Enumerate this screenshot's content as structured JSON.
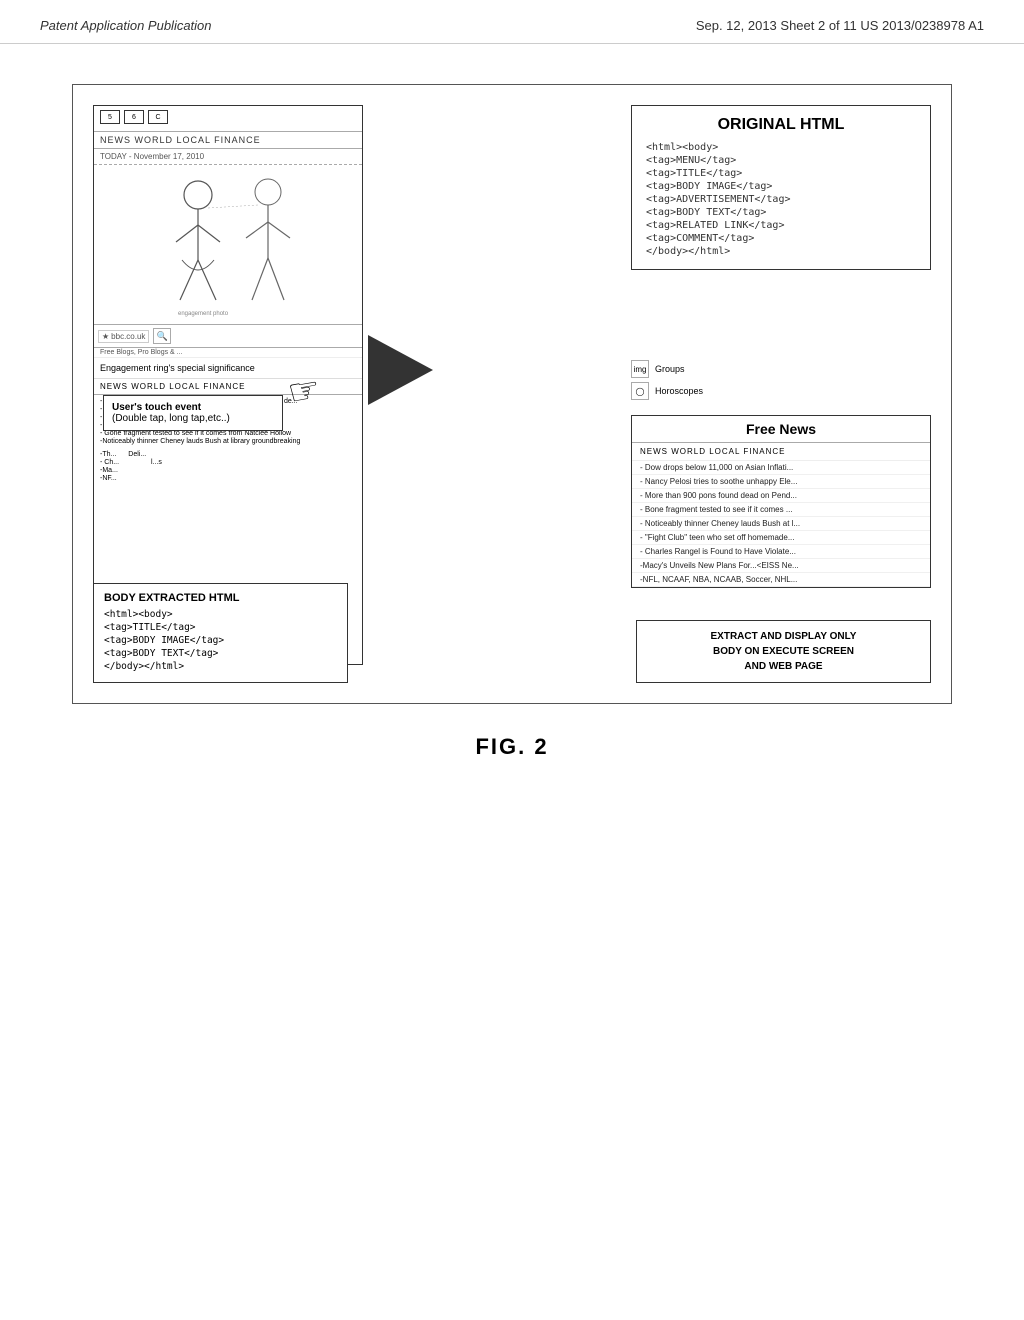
{
  "header": {
    "left": "Patent Application Publication",
    "right": "Sep. 12, 2013    Sheet 2 of 11    US 2013/0238978 A1"
  },
  "diagram": {
    "left_panel": {
      "tabs": [
        "5",
        "6",
        "C"
      ],
      "nav": "NEWS  WORLD  LOCAL  FINANCE",
      "date": "TODAY - November 17, 2010",
      "address": "bbc.co.uk",
      "address_star": "★",
      "address_label": "Free Blogs, Pro Blogs & ...",
      "headline": "Engagement ring's special significance",
      "nav2": "NEWS  WORLD  LOCAL  FINANCE",
      "news_items": [
        "- Dow drops below 11,000 on Asian Inflation and European de...",
        "- N...",
        "- M...",
        "- N...",
        "- Gone fragment tested to see if it comes from Natclee Hollow",
        "-Noticeably thinner Cheney lauds Bush at library groundbreaking"
      ],
      "lower_news": [
        "-Th...",
        "- Ch...",
        "-Ma...",
        "-NF..."
      ]
    },
    "touch_event_box": {
      "line1": "User's touch event",
      "line2": "(Double tap, long tap,etc..)"
    },
    "original_html_panel": {
      "title": "ORIGINAL HTML",
      "lines": [
        "<html><body>",
        "<tag>MENU</tag>",
        "<tag>TITLE</tag>",
        "<tag>BODY IMAGE</tag>",
        "<tag>ADVERTISEMENT</tag>",
        "<tag>BODY TEXT</tag>",
        "<tag>RELATED LINK</tag>",
        "<tag>COMMENT</tag>",
        "</body></html>"
      ]
    },
    "right_middle_items": [
      {
        "icon": "img",
        "label": "Groups"
      },
      {
        "icon": "◯",
        "label": "Horoscopes"
      }
    ],
    "free_news_panel": {
      "title": "Free News",
      "nav": "NEWS  WORLD  LOCAL  FINANCE",
      "news_items": [
        "- Dow drops below 11,000 on Asian Inflati...",
        "- Nancy Pelosi tries to soothe unhappy Ele...",
        "- More than 900 pons found dead on Pend...",
        "- Bone fragment tested to see if it comes ...",
        "- Noticeably thinner Cheney lauds Bush at l...",
        "- \"Fight Club\" teen who set off homemade...",
        "- Charles Rangel is Found to Have Violate...",
        "-Macy's Unveils New Plans For...<EISS Ne...",
        "-NFL, NCAAF, NBA, NCAAB, Soccer, NHL..."
      ]
    },
    "extract_box": {
      "text": "EXTRACT AND DISPLAY ONLY\nBODY ON EXECUTE SCREEN\nAND WEB PAGE"
    },
    "body_extracted": {
      "title": "BODY EXTRACTED HTML",
      "lines": [
        "<html><body>",
        "<tag>TITLE</tag>",
        "<tag>BODY IMAGE</tag>",
        "<tag>BODY TEXT</tag>",
        "</body></html>"
      ]
    }
  },
  "figure": {
    "label": "FIG. 2"
  }
}
